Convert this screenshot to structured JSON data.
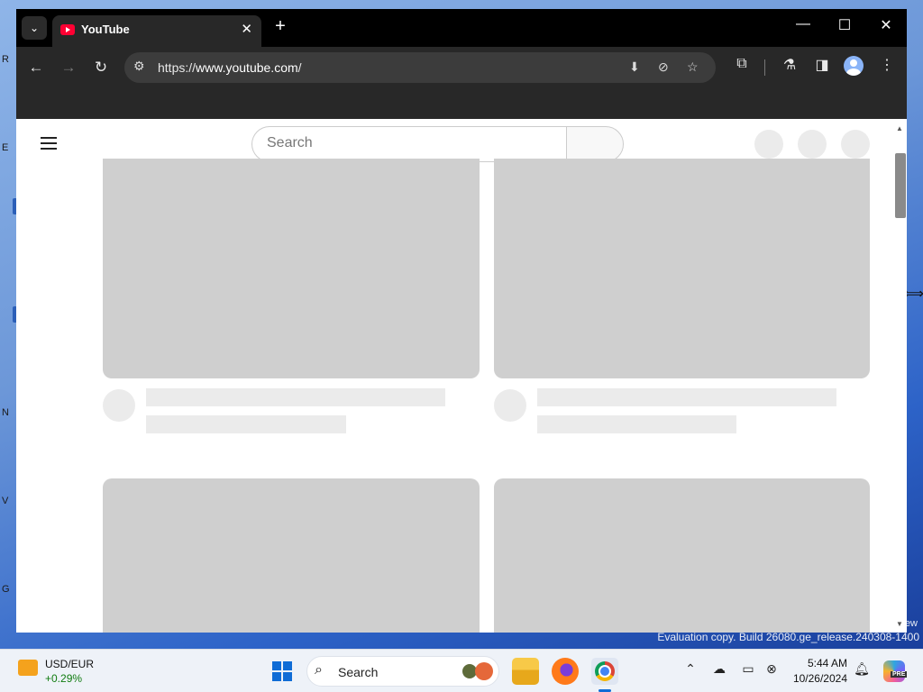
{
  "browser": {
    "tab_title": "YouTube",
    "tab_close": "✕",
    "new_tab": "+",
    "tab_search": "⌄",
    "url_scheme": "https://",
    "url_host": "www.youtube.com",
    "url_path": "/",
    "window_controls": {
      "minimize": "—",
      "maximize": "☐",
      "close": "✕"
    }
  },
  "youtube": {
    "search_placeholder": "Search"
  },
  "watermark": {
    "text": "Evaluation copy. Build 26080.ge_release.240308-1400",
    "tail": "ew"
  },
  "taskbar": {
    "widget_title": "USD/EUR",
    "widget_value": "+0.29%",
    "search_label": "Search",
    "time": "5:44 AM",
    "date": "10/26/2024",
    "copilot_badge": "PRE"
  },
  "desktop_edge_labels": [
    "R",
    "E",
    "N",
    "V",
    "G"
  ],
  "colors": {
    "accent": "#0f6cd6",
    "youtube_red": "#ff0033",
    "skeleton": "#cfcfcf"
  }
}
